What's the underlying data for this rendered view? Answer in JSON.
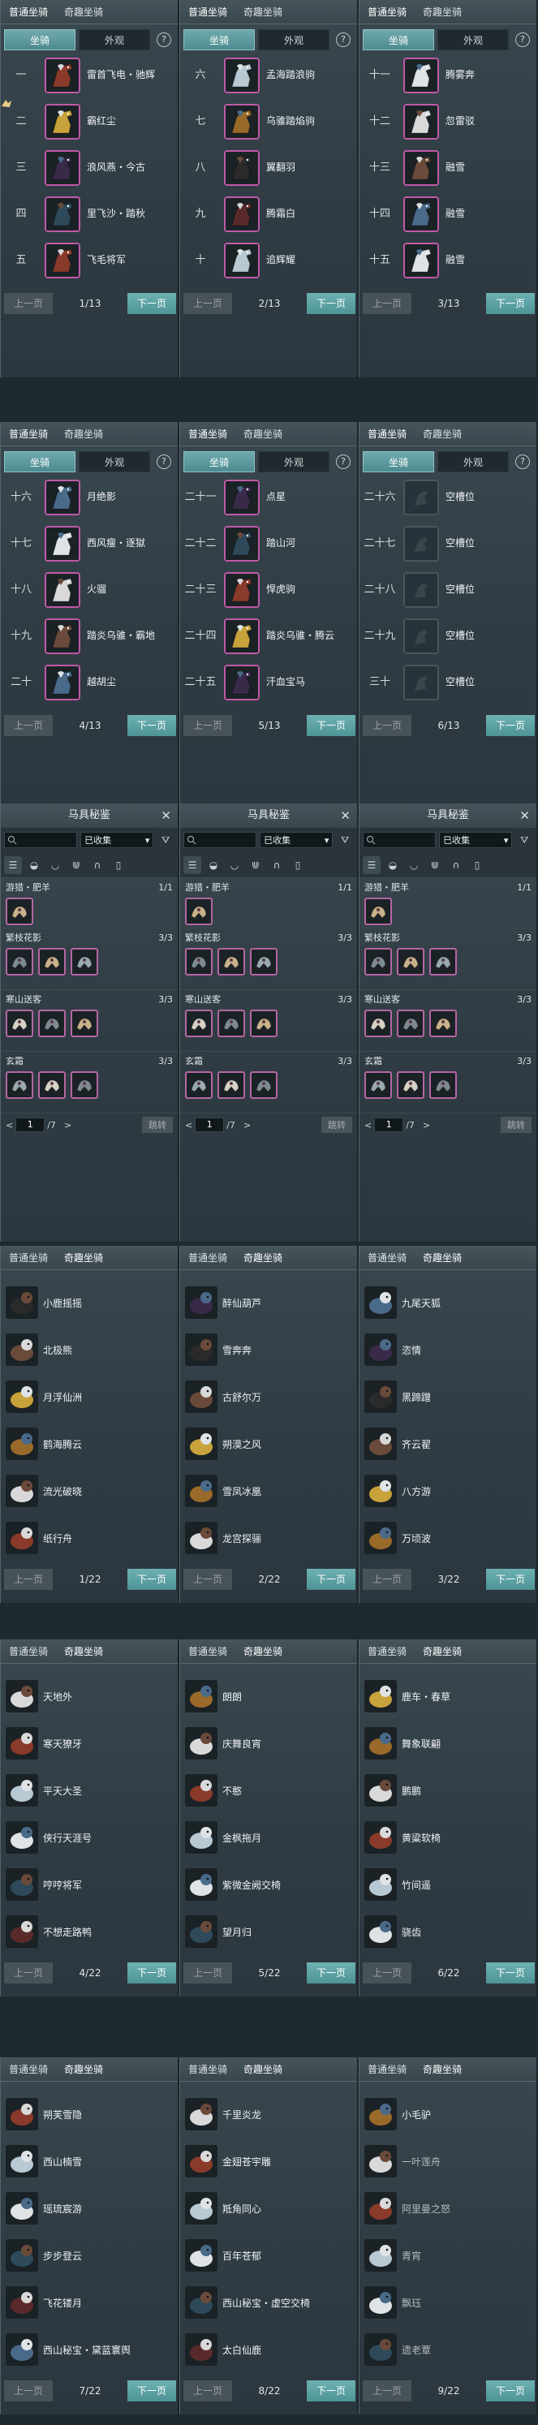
{
  "tabs": {
    "normal": "普通坐骑",
    "special": "奇趣坐骑"
  },
  "subtabs": {
    "mount": "坐骑",
    "appearance": "外观",
    "help": "?"
  },
  "pager": {
    "prev": "上一页",
    "next": "下一页"
  },
  "colors": {
    "accent": "#5aa3a6",
    "frame": "#c05aa6",
    "bg": "#1f2a30"
  },
  "section1": [
    {
      "page": "1/13",
      "rows": [
        {
          "num": "一",
          "name": "雷首飞电・驰辉"
        },
        {
          "num": "二",
          "name": "霸红尘"
        },
        {
          "num": "三",
          "name": "浪风燕・今古"
        },
        {
          "num": "四",
          "name": "里飞沙・踏秋"
        },
        {
          "num": "五",
          "name": "飞毛将军"
        }
      ]
    },
    {
      "page": "2/13",
      "rows": [
        {
          "num": "六",
          "name": "孟海踏浪驹"
        },
        {
          "num": "七",
          "name": "乌骓踏焰驹"
        },
        {
          "num": "八",
          "name": "翼翻羽"
        },
        {
          "num": "九",
          "name": "腾霜白"
        },
        {
          "num": "十",
          "name": "追辉耀"
        }
      ]
    },
    {
      "page": "3/13",
      "rows": [
        {
          "num": "十一",
          "name": "腾雾奔"
        },
        {
          "num": "十二",
          "name": "忽雷驳"
        },
        {
          "num": "十三",
          "name": "融雪"
        },
        {
          "num": "十四",
          "name": "融雪"
        },
        {
          "num": "十五",
          "name": "融雪"
        }
      ]
    }
  ],
  "section2": [
    {
      "page": "4/13",
      "rows": [
        {
          "num": "十六",
          "name": "月绝影"
        },
        {
          "num": "十七",
          "name": "西风瘦・逐獄"
        },
        {
          "num": "十八",
          "name": "火骝"
        },
        {
          "num": "十九",
          "name": "踏炎乌骓・霸地"
        },
        {
          "num": "二十",
          "name": "越胡尘"
        }
      ]
    },
    {
      "page": "5/13",
      "rows": [
        {
          "num": "二十一",
          "name": "点星"
        },
        {
          "num": "二十二",
          "name": "踏山河"
        },
        {
          "num": "二十三",
          "name": "悍虎驹"
        },
        {
          "num": "二十四",
          "name": "踏炎乌骓・腾云"
        },
        {
          "num": "二十五",
          "name": "汗血宝马"
        }
      ]
    },
    {
      "page": "6/13",
      "rows": [
        {
          "num": "二十六",
          "name": "空槽位"
        },
        {
          "num": "二十七",
          "name": "空槽位"
        },
        {
          "num": "二十八",
          "name": "空槽位"
        },
        {
          "num": "二十九",
          "name": "空槽位"
        },
        {
          "num": "三十",
          "name": "空槽位"
        }
      ]
    }
  ],
  "collection": {
    "title": "马具秘鉴",
    "close": "✕",
    "filter": "已收集",
    "page_input": "1",
    "page_total": "/7",
    "jump": "跳转",
    "groups": [
      {
        "name": "游猎・肥羊",
        "count": "1/1",
        "items": 1
      },
      {
        "name": "繁枝花影",
        "count": "3/3",
        "items": 3
      },
      {
        "name": "寒山送客",
        "count": "3/3",
        "items": 3
      },
      {
        "name": "玄霜",
        "count": "3/3",
        "items": 3
      }
    ]
  },
  "section4": [
    {
      "page": "1/22",
      "items": [
        "小鹿摇摇",
        "北极熊",
        "月浮仙洲",
        "鹤海腾云",
        "流光破晓",
        "纸行舟"
      ]
    },
    {
      "page": "2/22",
      "items": [
        "醉仙葫芦",
        "雪奔奔",
        "古舒尔万",
        "朔漠之风",
        "雪凤冰凰",
        "龙宫探骊"
      ]
    },
    {
      "page": "3/22",
      "items": [
        "九尾天狐",
        "恣情",
        "黑蹄蹭",
        "齐云翟",
        "八方游",
        "万顷波"
      ]
    }
  ],
  "section5": [
    {
      "page": "4/22",
      "items": [
        "天地外",
        "寒天獠牙",
        "平天大圣",
        "侠行天涯号",
        "哼哼将军",
        "不想走路鸭"
      ]
    },
    {
      "page": "5/22",
      "items": [
        "朗朗",
        "庆舞良宵",
        "不憨",
        "金枫拖月",
        "紫微金阙交椅",
        "望月归"
      ]
    },
    {
      "page": "6/22",
      "items": [
        "鹿车・春草",
        "舞象联翩",
        "鹏鹏",
        "黄粱软椅",
        "竹间遥",
        "骁齿"
      ]
    }
  ],
  "section6": [
    {
      "page": "7/22",
      "items": [
        "朔芙雪隐",
        "西山楠雪",
        "瑶琉宸游",
        "步步登云",
        "飞花镂月",
        "西山秘宝・黛蓝寰舆"
      ]
    },
    {
      "page": "8/22",
      "items": [
        "千里炎龙",
        "金翅苍宇雕",
        "羝角同心",
        "百年苍郁",
        "西山秘宝・虚空交椅",
        "太白仙鹿"
      ]
    },
    {
      "page": "9/22",
      "items": [
        "小毛驴",
        "一叶莲舟",
        "阿里曼之怒",
        "青宵",
        "飘珏",
        "遗老覃"
      ]
    }
  ]
}
